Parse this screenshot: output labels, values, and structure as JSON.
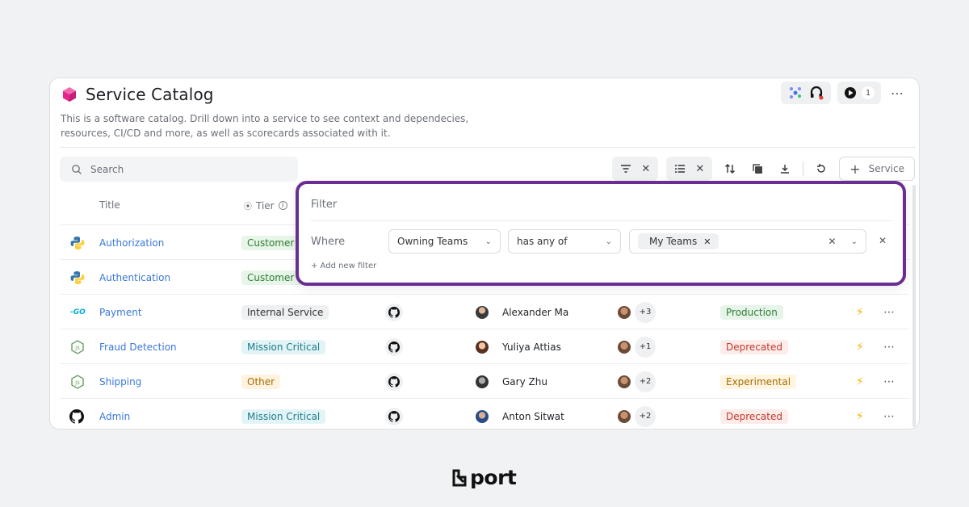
{
  "header": {
    "title": "Service Catalog",
    "description": "This is a software catalog. Drill down into a service to see context and dependecies, resources, CI/CD and more, as well as scorecards associated with it.",
    "notification_count": "1"
  },
  "search": {
    "placeholder": "Search"
  },
  "toolbar": {
    "add_service_label": "Service"
  },
  "columns": {
    "title": "Title",
    "tier": "Tier"
  },
  "rows": [
    {
      "name": "Authorization",
      "icon": "python-icon",
      "tier": "Customer",
      "tier_color": "#e8f5e9",
      "tier_text_color": "#2e7d32"
    },
    {
      "name": "Authentication",
      "icon": "python-icon",
      "tier": "Customer F",
      "tier_color": "#e8f5e9",
      "tier_text_color": "#2e7d32"
    },
    {
      "name": "Payment",
      "icon": "go-icon",
      "tier": "Internal Service",
      "owner": "Alexander Ma",
      "team_more": "+3",
      "lifecycle": "Production"
    },
    {
      "name": "Fraud Detection",
      "icon": "nodejs-icon",
      "tier": "Mission Critical",
      "owner": "Yuliya Attias",
      "team_more": "+1",
      "lifecycle": "Deprecated"
    },
    {
      "name": "Shipping",
      "icon": "nodejs-icon",
      "tier": "Other",
      "owner": "Gary Zhu",
      "team_more": "+2",
      "lifecycle": "Experimental"
    },
    {
      "name": "Admin",
      "icon": "github-icon",
      "tier": "Mission Critical",
      "owner": "Anton Sitwat",
      "team_more": "+2",
      "lifecycle": "Deprecated"
    }
  ],
  "filter": {
    "title": "Filter",
    "where": "Where",
    "property": "Owning Teams",
    "operator": "has any of",
    "value_chip": "My Teams",
    "add_label": "+ Add new filter"
  },
  "brand": {
    "name": "port"
  },
  "colors": {
    "accent": "#3a78d8",
    "highlight_border": "#6a2d91",
    "production_bg": "#e6f4ea",
    "production_fg": "#2e7d32",
    "deprecated_bg": "#fdecea",
    "deprecated_fg": "#c0392b",
    "experimental_bg": "#fff5e0",
    "experimental_fg": "#a86b00",
    "internal_bg": "#eef0f2",
    "mission_bg": "#e3f4f7",
    "mission_fg": "#1b7c8c",
    "other_bg": "#fff3e0",
    "other_fg": "#a86b00"
  }
}
